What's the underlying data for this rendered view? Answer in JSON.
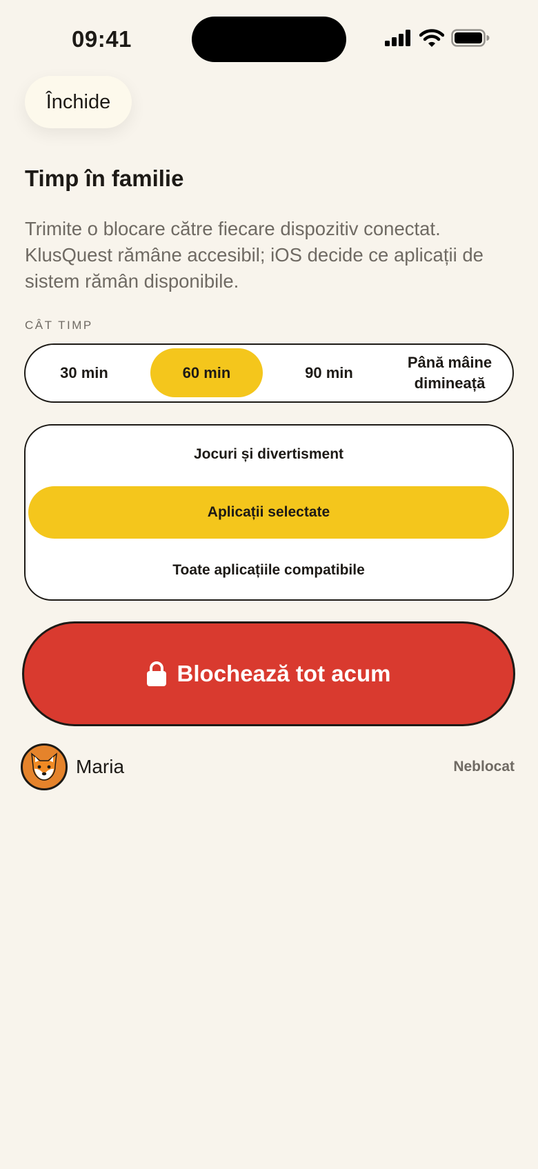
{
  "status_bar": {
    "time": "09:41",
    "icons": [
      "cellular-signal-icon",
      "wifi-icon",
      "battery-icon"
    ]
  },
  "header": {
    "close_label": "Închide"
  },
  "main": {
    "title": "Timp în familie",
    "description": "Trimite o blocare către fiecare dispozitiv conectat. KlusQuest rămâne accesibil; iOS decide ce aplicații de sistem rămân disponibile.",
    "duration_label": "CÂT TIMP",
    "durations": [
      {
        "label": "30 min",
        "selected": false
      },
      {
        "label": "60 min",
        "selected": true
      },
      {
        "label": "90 min",
        "selected": false
      },
      {
        "label": "Până mâine dimineață",
        "selected": false
      }
    ],
    "scopes": [
      {
        "label": "Jocuri și divertisment",
        "selected": false
      },
      {
        "label": "Aplicații selectate",
        "selected": true
      },
      {
        "label": "Toate aplicațiile compatibile",
        "selected": false
      }
    ],
    "lock_button": {
      "label": "Blochează tot acum",
      "icon": "lock-icon"
    },
    "children": [
      {
        "name": "Maria",
        "status": "Neblocat",
        "avatar_icon": "fox-icon"
      }
    ]
  },
  "colors": {
    "background": "#f8f4ec",
    "accent_yellow": "#f4c61c",
    "danger_red": "#d93a2f",
    "text_primary": "#1d1a16",
    "text_secondary": "#6f6a63",
    "avatar_orange": "#e5832b"
  }
}
